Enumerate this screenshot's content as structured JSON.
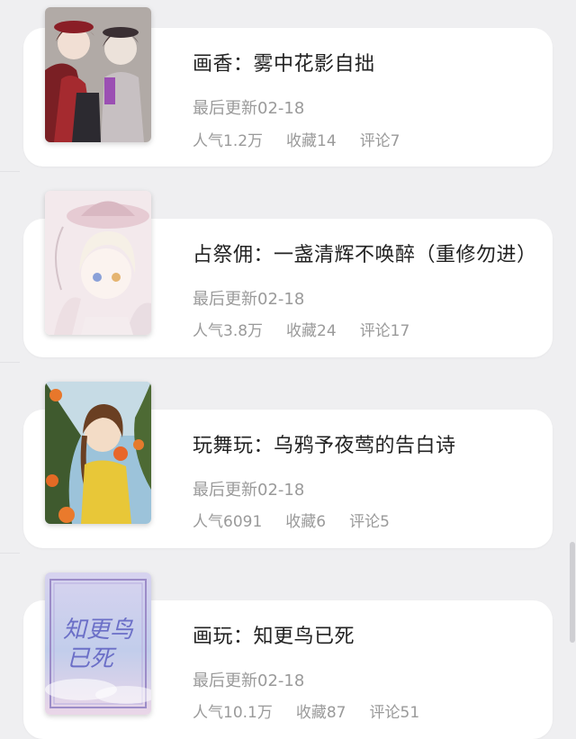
{
  "items": [
    {
      "title": "画香：雾中花影自拙",
      "updated": "最后更新02-18",
      "popularity": "人气1.2万",
      "favorites": "收藏14",
      "comments": "评论7",
      "cover_icon": "anime-girls-cover"
    },
    {
      "title": "占祭佣：一盏清辉不唤醉（重修勿进）",
      "updated": "最后更新02-18",
      "popularity": "人气3.8万",
      "favorites": "收藏24",
      "comments": "评论17",
      "cover_icon": "pastel-girl-cover"
    },
    {
      "title": "玩舞玩：乌鸦予夜莺的告白诗",
      "updated": "最后更新02-18",
      "popularity": "人气6091",
      "favorites": "收藏6",
      "comments": "评论5",
      "cover_icon": "orange-tree-girl-cover"
    },
    {
      "title": "画玩：知更鸟已死",
      "updated": "最后更新02-18",
      "popularity": "人气10.1万",
      "favorites": "收藏87",
      "comments": "评论51",
      "cover_icon": "robin-title-cover",
      "cover_lettering": "知更鸟已死"
    }
  ],
  "colors": {
    "page_bg": "#efeff1",
    "card_bg": "#ffffff",
    "title_text": "#222222",
    "meta_text": "#9a9a9a"
  }
}
